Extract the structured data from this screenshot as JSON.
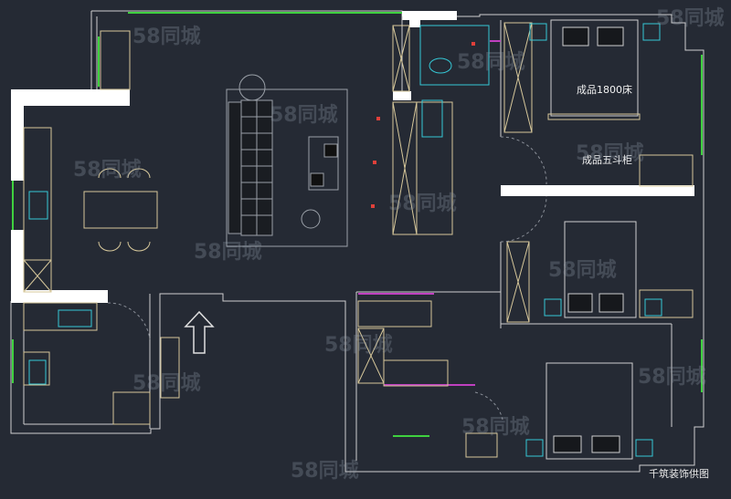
{
  "labels": {
    "bed_1800": "成品1800床",
    "dresser": "成品五斗柜"
  },
  "watermark": "58同城",
  "credit": "千筑装饰供图",
  "colors": {
    "background": "#252a34",
    "wall_fill": "#ffffff",
    "furniture_line": "#d6c79a",
    "window_green": "#3fd13f",
    "cyan": "#35c8d6",
    "magenta": "#c040c0",
    "red": "#e0403a"
  }
}
